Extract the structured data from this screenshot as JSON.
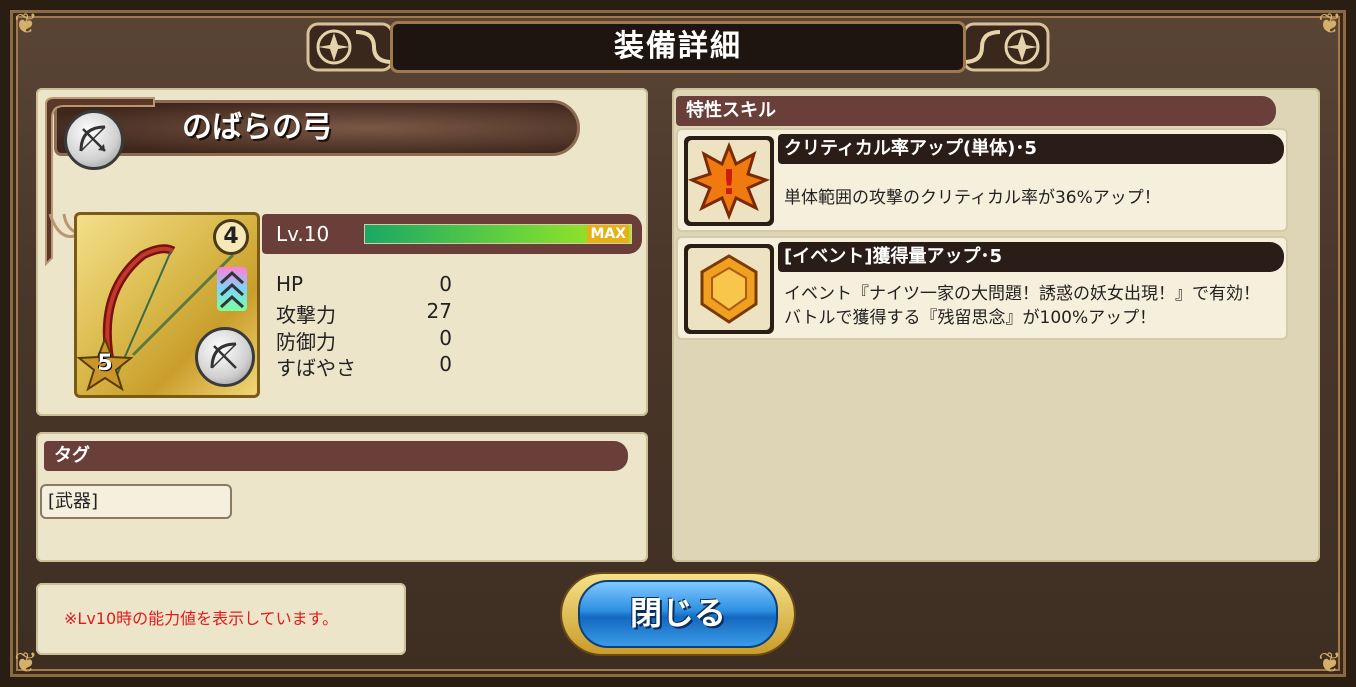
{
  "title": "装備詳細",
  "item": {
    "name": "のばらの弓",
    "rarity": "5",
    "level_badge": "4",
    "level_label": "Lv.10",
    "level_progress": 1.0,
    "max_label": "MAX",
    "stats": [
      {
        "label": "HP",
        "value": "0"
      },
      {
        "label": "攻撃力",
        "value": "27"
      },
      {
        "label": "防御力",
        "value": "0"
      },
      {
        "label": "すばやさ",
        "value": "0"
      }
    ]
  },
  "tags": {
    "header": "タグ",
    "items": [
      "[武器]"
    ]
  },
  "skills": {
    "header": "特性スキル",
    "items": [
      {
        "icon": "critical-icon",
        "title": "クリティカル率アップ(単体)･5",
        "desc": [
          "単体範囲の攻撃のクリティカル率が36%アップ！"
        ]
      },
      {
        "icon": "gem-icon",
        "title": "[イベント]獲得量アップ･5",
        "desc": [
          "イベント『ナイツ一家の大問題！誘惑の妖女出現！』で有効！",
          "バトルで獲得する『残留思念』が100%アップ！"
        ]
      }
    ]
  },
  "note": "※Lv10時の能力値を表示しています。",
  "close_label": "閉じる",
  "colors": {
    "panel": "#ece5ca",
    "header": "#6a3f3a",
    "note_text": "#e11b1b",
    "button_blue": "#2d8fe0"
  }
}
